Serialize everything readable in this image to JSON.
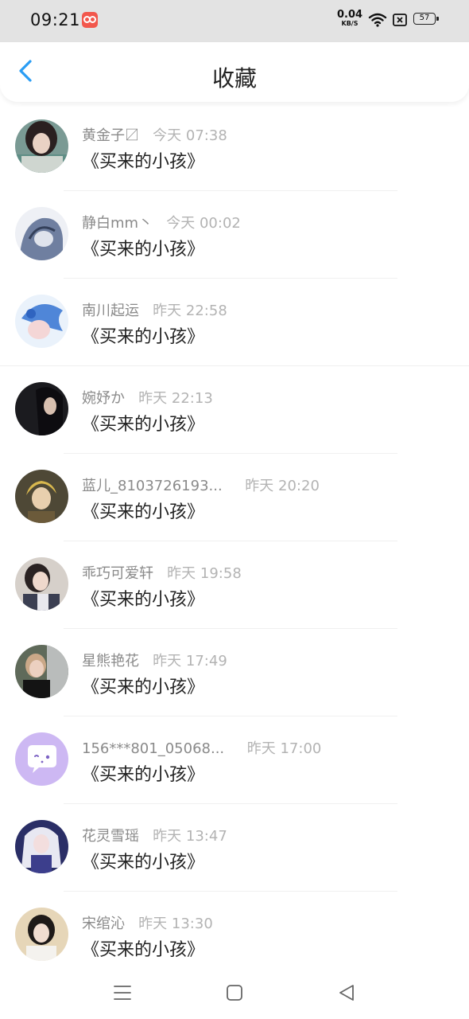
{
  "status_bar": {
    "time": "09:21",
    "net_speed_value": "0.04",
    "net_speed_unit": "KB/S",
    "battery_level": "57"
  },
  "header": {
    "title": "收藏",
    "back_icon": "chevron-left-icon",
    "accent_color": "#2a9df4"
  },
  "items": [
    {
      "nick": "黄金子〼",
      "time": "今天 07:38",
      "text": "《买来的小孩》"
    },
    {
      "nick": "静白mm丶",
      "time": "今天 00:02",
      "text": "《买来的小孩》"
    },
    {
      "nick": "南川起运",
      "time": "昨天 22:58",
      "text": "《买来的小孩》"
    },
    {
      "nick": "婉妤か",
      "time": "昨天 22:13",
      "text": "《买来的小孩》"
    },
    {
      "nick": "蓝儿_8103726193...",
      "time": "昨天 20:20",
      "text": "《买来的小孩》"
    },
    {
      "nick": "乖巧可爱轩",
      "time": "昨天 19:58",
      "text": "《买来的小孩》"
    },
    {
      "nick": "星熊艳花",
      "time": "昨天 17:49",
      "text": "《买来的小孩》"
    },
    {
      "nick": "156***801_05068...",
      "time": "昨天 17:00",
      "text": "《买来的小孩》"
    },
    {
      "nick": "花灵雪瑶",
      "time": "昨天 13:47",
      "text": "《买来的小孩》"
    },
    {
      "nick": "宋绾沁",
      "time": "昨天 13:30",
      "text": "《买来的小孩》"
    }
  ],
  "system_nav": {
    "menu_icon": "menu-icon",
    "home_icon": "home-square-icon",
    "back_icon": "back-triangle-icon"
  }
}
